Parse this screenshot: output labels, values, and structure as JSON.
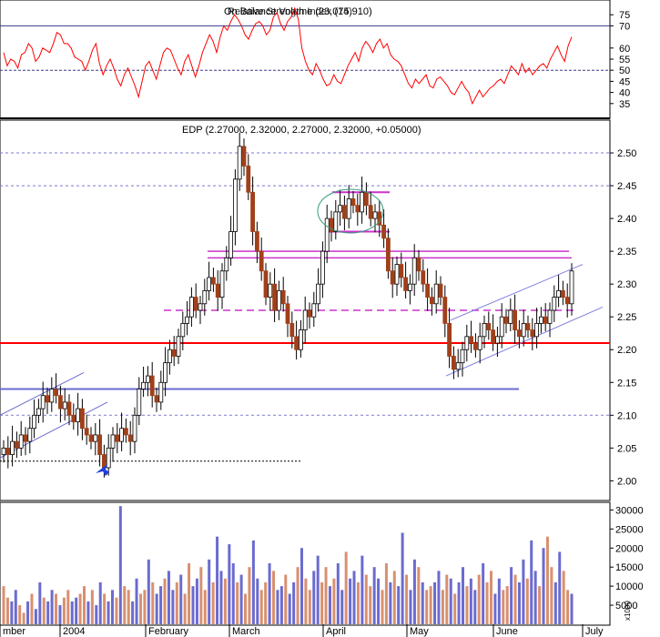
{
  "chart_data": [
    {
      "type": "line",
      "title": "Relative Strength Index (14)",
      "overlap_title": "On Balance Volume (23,075.910)",
      "ylim": [
        30,
        80
      ],
      "yticks": [
        35,
        40,
        45,
        50,
        55,
        60,
        70,
        75
      ],
      "levels": [
        70,
        50
      ],
      "colors": {
        "line": "#ff0000",
        "level": "#3a3a8c"
      },
      "values": [
        58,
        52,
        55,
        54,
        51,
        57,
        58,
        62,
        60,
        54,
        56,
        60,
        59,
        58,
        62,
        67,
        66,
        62,
        62,
        60,
        56,
        55,
        54,
        50,
        54,
        59,
        62,
        53,
        48,
        52,
        55,
        51,
        46,
        43,
        48,
        51,
        47,
        43,
        38,
        45,
        52,
        54,
        50,
        46,
        52,
        58,
        60,
        59,
        55,
        51,
        48,
        54,
        57,
        52,
        47,
        52,
        58,
        62,
        66,
        63,
        58,
        65,
        70,
        68,
        72,
        75,
        73,
        70,
        66,
        64,
        68,
        71,
        72,
        70,
        66,
        68,
        74,
        76,
        71,
        68,
        72,
        74,
        78,
        73,
        60,
        54,
        50,
        48,
        53,
        50,
        46,
        43,
        44,
        48,
        45,
        44,
        48,
        52,
        55,
        58,
        54,
        60,
        63,
        61,
        58,
        62,
        64,
        60,
        62,
        57,
        55,
        54,
        52,
        48,
        44,
        42,
        46,
        44,
        46,
        48,
        43,
        42,
        46,
        47,
        45,
        43,
        40,
        39,
        42,
        45,
        42,
        40,
        35,
        38,
        41,
        38,
        40,
        42,
        43,
        45,
        46,
        44,
        48,
        52,
        50,
        48,
        53,
        49,
        51,
        48,
        50,
        52,
        53,
        51,
        55,
        58,
        61,
        57,
        54,
        61,
        65
      ]
    },
    {
      "type": "candlestick",
      "title": "EDP (2.27000, 2.32000, 2.27000, 2.32000, +0.05000)",
      "ylim": [
        1.97,
        2.55
      ],
      "yticks": [
        2.0,
        2.05,
        2.1,
        2.15,
        2.2,
        2.25,
        2.3,
        2.35,
        2.4,
        2.45,
        2.5
      ],
      "colors": {
        "up": "#ffffff",
        "down": "#a0401a",
        "outline": "#000000"
      },
      "x_labels": [
        "mber",
        "2004",
        "February",
        "March",
        "April",
        "May",
        "June",
        "July"
      ],
      "support_resistance": [
        2.21,
        2.14,
        2.26,
        2.34,
        2.35,
        2.38,
        2.44,
        2.45,
        2.5,
        2.03
      ],
      "closes": [
        2.05,
        2.04,
        2.06,
        2.05,
        2.07,
        2.06,
        2.08,
        2.1,
        2.11,
        2.13,
        2.12,
        2.14,
        2.13,
        2.11,
        2.12,
        2.1,
        2.09,
        2.11,
        2.08,
        2.07,
        2.06,
        2.07,
        2.04,
        2.02,
        2.05,
        2.07,
        2.06,
        2.08,
        2.07,
        2.06,
        2.1,
        2.14,
        2.15,
        2.16,
        2.13,
        2.12,
        2.15,
        2.18,
        2.2,
        2.19,
        2.22,
        2.24,
        2.25,
        2.28,
        2.26,
        2.27,
        2.29,
        2.31,
        2.3,
        2.28,
        2.32,
        2.34,
        2.38,
        2.46,
        2.51,
        2.48,
        2.44,
        2.38,
        2.35,
        2.32,
        2.28,
        2.3,
        2.26,
        2.29,
        2.27,
        2.24,
        2.22,
        2.2,
        2.23,
        2.26,
        2.25,
        2.27,
        2.3,
        2.35,
        2.4,
        2.38,
        2.41,
        2.42,
        2.4,
        2.43,
        2.42,
        2.41,
        2.44,
        2.42,
        2.4,
        2.41,
        2.39,
        2.37,
        2.32,
        2.3,
        2.33,
        2.31,
        2.29,
        2.3,
        2.34,
        2.32,
        2.3,
        2.28,
        2.27,
        2.3,
        2.28,
        2.24,
        2.19,
        2.17,
        2.18,
        2.2,
        2.22,
        2.21,
        2.2,
        2.22,
        2.24,
        2.23,
        2.21,
        2.22,
        2.25,
        2.24,
        2.26,
        2.23,
        2.22,
        2.24,
        2.23,
        2.22,
        2.24,
        2.25,
        2.24,
        2.26,
        2.28,
        2.29,
        2.28,
        2.27,
        2.32
      ]
    },
    {
      "type": "bar",
      "title": "",
      "ylabel": "x1000",
      "ylim": [
        0,
        32000
      ],
      "yticks": [
        5000,
        10000,
        15000,
        20000,
        25000,
        30000
      ],
      "values": [
        10000,
        7000,
        6000,
        9000,
        5000,
        3000,
        6000,
        8000,
        4000,
        11000,
        7000,
        6000,
        9000,
        8000,
        5000,
        7000,
        9000,
        6000,
        7000,
        8000,
        10000,
        6000,
        9000,
        5000,
        11000,
        8000,
        6000,
        9000,
        7000,
        31000,
        10000,
        9000,
        6000,
        12000,
        8000,
        9000,
        17000,
        11000,
        8000,
        10000,
        12000,
        14000,
        9000,
        11000,
        13000,
        8000,
        16000,
        10000,
        12000,
        15000,
        9000,
        17000,
        11000,
        23000,
        14000,
        12000,
        21000,
        16000,
        11000,
        13000,
        8000,
        15000,
        22000,
        12000,
        9000,
        11000,
        16000,
        14000,
        9000,
        10000,
        13000,
        8000,
        11000,
        15000,
        20000,
        12000,
        9000,
        14000,
        18000,
        11000,
        15000,
        10000,
        12000,
        16000,
        9000,
        19000,
        12000,
        14000,
        11000,
        18000,
        13000,
        10000,
        15000,
        12000,
        9000,
        16000,
        11000,
        14000,
        10000,
        24000,
        13000,
        9000,
        17000,
        15000,
        11000,
        9000,
        10000,
        11000,
        14000,
        9000,
        13000,
        12000,
        8000,
        11000,
        15000,
        10000,
        12000,
        9000,
        13000,
        16000,
        11000,
        14000,
        8000,
        12000,
        9000,
        10000,
        15000,
        13000,
        11000,
        17000,
        12000,
        22000,
        14000,
        10000,
        20000,
        23000,
        15000,
        11000,
        19000,
        14000,
        9000,
        8000
      ],
      "colors": {
        "up": "#6b6bd0",
        "down": "#d89070"
      }
    }
  ]
}
